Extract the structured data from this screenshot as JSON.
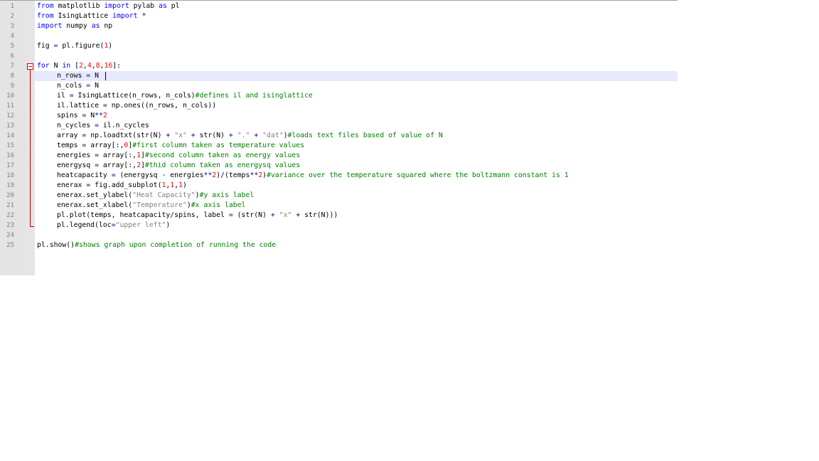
{
  "lines": [
    {
      "number": "1",
      "indent": 0,
      "tokens": [
        {
          "t": "from",
          "c": "kw"
        },
        {
          "t": " matplotlib ",
          "c": ""
        },
        {
          "t": "import",
          "c": "kw"
        },
        {
          "t": " pylab ",
          "c": ""
        },
        {
          "t": "as",
          "c": "kw"
        },
        {
          "t": " pl",
          "c": ""
        }
      ]
    },
    {
      "number": "2",
      "indent": 0,
      "tokens": [
        {
          "t": "from",
          "c": "kw"
        },
        {
          "t": " IsingLattice ",
          "c": ""
        },
        {
          "t": "import",
          "c": "kw"
        },
        {
          "t": " *",
          "c": "op"
        }
      ]
    },
    {
      "number": "3",
      "indent": 0,
      "tokens": [
        {
          "t": "import",
          "c": "kw"
        },
        {
          "t": " numpy ",
          "c": ""
        },
        {
          "t": "as",
          "c": "kw"
        },
        {
          "t": " np",
          "c": ""
        }
      ]
    },
    {
      "number": "4",
      "indent": 0,
      "tokens": []
    },
    {
      "number": "5",
      "indent": 0,
      "tokens": [
        {
          "t": "fig ",
          "c": ""
        },
        {
          "t": "=",
          "c": "op"
        },
        {
          "t": " pl.figure(",
          "c": ""
        },
        {
          "t": "1",
          "c": "num"
        },
        {
          "t": ")",
          "c": ""
        }
      ]
    },
    {
      "number": "6",
      "indent": 0,
      "tokens": []
    },
    {
      "number": "7",
      "indent": 0,
      "tokens": [
        {
          "t": "for",
          "c": "kw"
        },
        {
          "t": " N ",
          "c": ""
        },
        {
          "t": "in",
          "c": "kw"
        },
        {
          "t": " [",
          "c": ""
        },
        {
          "t": "2",
          "c": "num"
        },
        {
          "t": ",",
          "c": ""
        },
        {
          "t": "4",
          "c": "num"
        },
        {
          "t": ",",
          "c": ""
        },
        {
          "t": "8",
          "c": "num"
        },
        {
          "t": ",",
          "c": ""
        },
        {
          "t": "16",
          "c": "num"
        },
        {
          "t": "]:",
          "c": ""
        }
      ]
    },
    {
      "number": "8",
      "indent": 1,
      "current": true,
      "tokens": [
        {
          "t": "n_rows ",
          "c": ""
        },
        {
          "t": "=",
          "c": "op"
        },
        {
          "t": " N",
          "c": ""
        }
      ]
    },
    {
      "number": "9",
      "indent": 1,
      "tokens": [
        {
          "t": "n_cols ",
          "c": ""
        },
        {
          "t": "=",
          "c": "op"
        },
        {
          "t": " N",
          "c": ""
        }
      ]
    },
    {
      "number": "10",
      "indent": 1,
      "tokens": [
        {
          "t": "il ",
          "c": ""
        },
        {
          "t": "=",
          "c": "op"
        },
        {
          "t": " IsingLattice(n_rows, n_cols)",
          "c": ""
        },
        {
          "t": "#defines il and isinglattice",
          "c": "cm"
        }
      ]
    },
    {
      "number": "11",
      "indent": 1,
      "tokens": [
        {
          "t": "il.lattice ",
          "c": ""
        },
        {
          "t": "=",
          "c": "op"
        },
        {
          "t": " np.ones((n_rows, n_cols))",
          "c": ""
        }
      ]
    },
    {
      "number": "12",
      "indent": 1,
      "tokens": [
        {
          "t": "spins ",
          "c": ""
        },
        {
          "t": "=",
          "c": "op"
        },
        {
          "t": " N",
          "c": ""
        },
        {
          "t": "**",
          "c": "op"
        },
        {
          "t": "2",
          "c": "num"
        }
      ]
    },
    {
      "number": "13",
      "indent": 1,
      "tokens": [
        {
          "t": "n_cycles ",
          "c": ""
        },
        {
          "t": "=",
          "c": "op"
        },
        {
          "t": " il.n_cycles",
          "c": ""
        }
      ]
    },
    {
      "number": "14",
      "indent": 1,
      "tokens": [
        {
          "t": "array ",
          "c": ""
        },
        {
          "t": "=",
          "c": "op"
        },
        {
          "t": " np.loadtxt(str(N) ",
          "c": ""
        },
        {
          "t": "+",
          "c": "op"
        },
        {
          "t": " ",
          "c": ""
        },
        {
          "t": "\"x\"",
          "c": "str"
        },
        {
          "t": " ",
          "c": ""
        },
        {
          "t": "+",
          "c": "op"
        },
        {
          "t": " str(N) ",
          "c": ""
        },
        {
          "t": "+",
          "c": "op"
        },
        {
          "t": " ",
          "c": ""
        },
        {
          "t": "\".\"",
          "c": "str"
        },
        {
          "t": " ",
          "c": ""
        },
        {
          "t": "+",
          "c": "op"
        },
        {
          "t": " ",
          "c": ""
        },
        {
          "t": "\"dat\"",
          "c": "str"
        },
        {
          "t": ")",
          "c": ""
        },
        {
          "t": "#loads text files based of value of N",
          "c": "cm"
        }
      ]
    },
    {
      "number": "15",
      "indent": 1,
      "tokens": [
        {
          "t": "temps ",
          "c": ""
        },
        {
          "t": "=",
          "c": "op"
        },
        {
          "t": " array[:,",
          "c": ""
        },
        {
          "t": "0",
          "c": "num"
        },
        {
          "t": "]",
          "c": ""
        },
        {
          "t": "#first column taken as temperature values",
          "c": "cm"
        }
      ]
    },
    {
      "number": "16",
      "indent": 1,
      "tokens": [
        {
          "t": "energies ",
          "c": ""
        },
        {
          "t": "=",
          "c": "op"
        },
        {
          "t": " array[:,",
          "c": ""
        },
        {
          "t": "1",
          "c": "num"
        },
        {
          "t": "]",
          "c": ""
        },
        {
          "t": "#second column taken as energy values",
          "c": "cm"
        }
      ]
    },
    {
      "number": "17",
      "indent": 1,
      "tokens": [
        {
          "t": "energysq ",
          "c": ""
        },
        {
          "t": "=",
          "c": "op"
        },
        {
          "t": " array[:,",
          "c": ""
        },
        {
          "t": "2",
          "c": "num"
        },
        {
          "t": "]",
          "c": ""
        },
        {
          "t": "#thid column taken as energysq values",
          "c": "cm"
        }
      ]
    },
    {
      "number": "18",
      "indent": 1,
      "tokens": [
        {
          "t": "heatcapacity ",
          "c": ""
        },
        {
          "t": "=",
          "c": "op"
        },
        {
          "t": " (energysq ",
          "c": ""
        },
        {
          "t": "-",
          "c": "op"
        },
        {
          "t": " energies",
          "c": ""
        },
        {
          "t": "**",
          "c": "op"
        },
        {
          "t": "2",
          "c": "num"
        },
        {
          "t": ")",
          "c": ""
        },
        {
          "t": "/",
          "c": "op"
        },
        {
          "t": "(temps",
          "c": ""
        },
        {
          "t": "**",
          "c": "op"
        },
        {
          "t": "2",
          "c": "num"
        },
        {
          "t": ")",
          "c": ""
        },
        {
          "t": "#variance over the temperature squared where the boltzmann constant is 1",
          "c": "cm"
        }
      ]
    },
    {
      "number": "19",
      "indent": 1,
      "tokens": [
        {
          "t": "enerax ",
          "c": ""
        },
        {
          "t": "=",
          "c": "op"
        },
        {
          "t": " fig.add_subplot(",
          "c": ""
        },
        {
          "t": "1",
          "c": "num"
        },
        {
          "t": ",",
          "c": ""
        },
        {
          "t": "1",
          "c": "num"
        },
        {
          "t": ",",
          "c": ""
        },
        {
          "t": "1",
          "c": "num"
        },
        {
          "t": ")",
          "c": ""
        }
      ]
    },
    {
      "number": "20",
      "indent": 1,
      "tokens": [
        {
          "t": "enerax.set_ylabel(",
          "c": ""
        },
        {
          "t": "\"Heat Capacity\"",
          "c": "str"
        },
        {
          "t": ")",
          "c": ""
        },
        {
          "t": "#y axis label",
          "c": "cm"
        }
      ]
    },
    {
      "number": "21",
      "indent": 1,
      "tokens": [
        {
          "t": "enerax.set_xlabel(",
          "c": ""
        },
        {
          "t": "\"Temperature\"",
          "c": "str"
        },
        {
          "t": ")",
          "c": ""
        },
        {
          "t": "#x axis label",
          "c": "cm"
        }
      ]
    },
    {
      "number": "22",
      "indent": 1,
      "tokens": [
        {
          "t": "pl.plot(temps, heatcapacity",
          "c": ""
        },
        {
          "t": "/",
          "c": "op"
        },
        {
          "t": "spins, label ",
          "c": ""
        },
        {
          "t": "=",
          "c": "op"
        },
        {
          "t": " (str(N) ",
          "c": ""
        },
        {
          "t": "+",
          "c": "op"
        },
        {
          "t": " ",
          "c": ""
        },
        {
          "t": "\"x\"",
          "c": "str"
        },
        {
          "t": " ",
          "c": ""
        },
        {
          "t": "+",
          "c": "op"
        },
        {
          "t": " str(N)))",
          "c": ""
        }
      ]
    },
    {
      "number": "23",
      "indent": 1,
      "tokens": [
        {
          "t": "pl.legend(loc",
          "c": ""
        },
        {
          "t": "=",
          "c": "op"
        },
        {
          "t": "\"upper left\"",
          "c": "str"
        },
        {
          "t": ")",
          "c": ""
        }
      ]
    },
    {
      "number": "24",
      "indent": 0,
      "tokens": []
    },
    {
      "number": "25",
      "indent": 0,
      "tokens": [
        {
          "t": "pl.show()",
          "c": ""
        },
        {
          "t": "#shows graph upon completion of running the code",
          "c": "cm"
        }
      ]
    }
  ]
}
